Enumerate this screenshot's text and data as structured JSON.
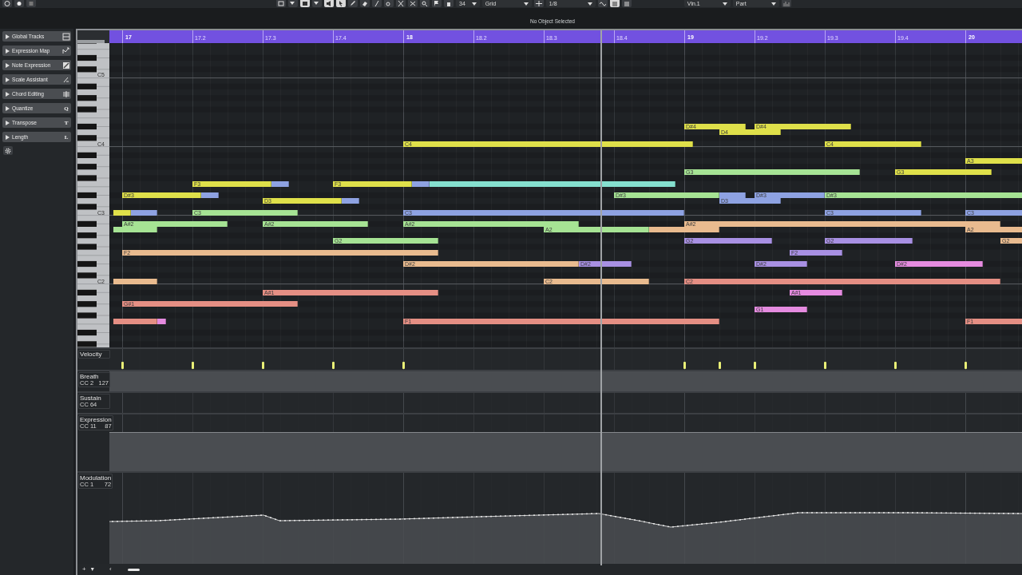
{
  "toolbar": {
    "step": "34",
    "snap_mode": "Grid",
    "quantize": "1/8",
    "track": "Vln.1",
    "part_scope": "Part"
  },
  "info_line": "No Object Selected",
  "inspector": [
    {
      "label": "Global Tracks",
      "expanded": false
    },
    {
      "label": "Expression Map",
      "expanded": false
    },
    {
      "label": "Note Expression",
      "expanded": false
    },
    {
      "label": "Scale Assistant",
      "expanded": false
    },
    {
      "label": "Chord Editing",
      "expanded": false
    },
    {
      "label": "Quantize",
      "expanded": false,
      "key": "Q"
    },
    {
      "label": "Transpose",
      "expanded": false,
      "key": "T"
    },
    {
      "label": "Length",
      "expanded": false,
      "key": "L"
    }
  ],
  "ruler": [
    {
      "label": "17",
      "kind": "bar"
    },
    {
      "label": "17.2",
      "kind": "beat"
    },
    {
      "label": "17.3",
      "kind": "beat"
    },
    {
      "label": "17.4",
      "kind": "beat"
    },
    {
      "label": "18",
      "kind": "bar"
    },
    {
      "label": "18.2",
      "kind": "beat"
    },
    {
      "label": "18.3",
      "kind": "beat"
    },
    {
      "label": "18.4",
      "kind": "beat"
    },
    {
      "label": "19",
      "kind": "bar"
    },
    {
      "label": "19.2",
      "kind": "beat"
    },
    {
      "label": "19.3",
      "kind": "beat"
    },
    {
      "label": "19.4",
      "kind": "beat"
    },
    {
      "label": "20",
      "kind": "bar"
    }
  ],
  "keyboard": {
    "labels": [
      "C5",
      "C4",
      "C3",
      "C2"
    ]
  },
  "notes": [
    {
      "label": "D#4",
      "color": "#dfe04a"
    },
    {
      "label": "D#4",
      "color": "#dfe04a"
    },
    {
      "label": "D4",
      "color": "#dfe04a"
    },
    {
      "label": "C4",
      "color": "#dfe04a"
    },
    {
      "label": "C4",
      "color": "#dfe04a"
    },
    {
      "label": "A3",
      "color": "#dfe04a"
    },
    {
      "label": "G3",
      "color": "#a6e394"
    },
    {
      "label": "G3",
      "color": "#dfe04a"
    },
    {
      "label": "F3",
      "color": "#dfe04a"
    },
    {
      "color": "#8ea2e2"
    },
    {
      "label": "F3",
      "color": "#dfe04a"
    },
    {
      "color": "#8ea2e2"
    },
    {
      "color": "#85e0cf"
    },
    {
      "label": "D#3",
      "color": "#dfe04a"
    },
    {
      "color": "#8ea2e2"
    },
    {
      "label": "D#3",
      "color": "#a6e394"
    },
    {
      "color": "#8ea2e2"
    },
    {
      "label": "D#3",
      "color": "#8ea2e2"
    },
    {
      "label": "D#3",
      "color": "#a6e394"
    },
    {
      "label": "D3",
      "color": "#dfe04a"
    },
    {
      "color": "#8ea2e2"
    },
    {
      "label": "D3",
      "color": "#8ea2e2"
    },
    {
      "color": "#dfe04a"
    },
    {
      "color": "#8ea2e2"
    },
    {
      "label": "C3",
      "color": "#a6e394"
    },
    {
      "label": "C3",
      "color": "#8ea2e2"
    },
    {
      "label": "C3",
      "color": "#8ea2e2"
    },
    {
      "label": "C3",
      "color": "#8ea2e2"
    },
    {
      "label": "A#2",
      "color": "#a6e394"
    },
    {
      "label": "A#2",
      "color": "#a6e394"
    },
    {
      "label": "A#2",
      "color": "#a6e394"
    },
    {
      "label": "A#2",
      "color": "#e9bb8f"
    },
    {
      "color": "#a6e394"
    },
    {
      "label": "A2",
      "color": "#a6e394"
    },
    {
      "color": "#e9bb8f"
    },
    {
      "label": "A2",
      "color": "#e9bb8f"
    },
    {
      "label": "G2",
      "color": "#a6e394"
    },
    {
      "label": "G2",
      "color": "#a890e3"
    },
    {
      "label": "G2",
      "color": "#a890e3"
    },
    {
      "label": "G2",
      "color": "#e9bb8f"
    },
    {
      "label": "F2",
      "color": "#e9bb8f"
    },
    {
      "label": "F2",
      "color": "#a890e3"
    },
    {
      "label": "D#2",
      "color": "#e9bb8f"
    },
    {
      "label": "D#2",
      "color": "#a890e3"
    },
    {
      "label": "D#2",
      "color": "#a890e3"
    },
    {
      "label": "D#2",
      "color": "#e58be0"
    },
    {
      "color": "#e9bb8f"
    },
    {
      "label": "C2",
      "color": "#e9bb8f"
    },
    {
      "label": "C2",
      "color": "#e58f84"
    },
    {
      "label": "A#1",
      "color": "#e58f84"
    },
    {
      "label": "A#1",
      "color": "#e58be0"
    },
    {
      "label": "G#1",
      "color": "#e58f84"
    },
    {
      "label": "G1",
      "color": "#e58be0"
    },
    {
      "color": "#e58f84"
    },
    {
      "color": "#e58be0"
    },
    {
      "label": "F1",
      "color": "#e58f84"
    },
    {
      "label": "F1",
      "color": "#e58f84"
    }
  ],
  "lanes": [
    {
      "kind": "velocity",
      "name": "Velocity"
    },
    {
      "kind": "cc",
      "name": "Breath",
      "cc": "CC 2",
      "value": "127"
    },
    {
      "kind": "cc",
      "name": "Sustain",
      "cc": "CC 64"
    },
    {
      "kind": "cc",
      "name": "Expression",
      "cc": "CC 11",
      "value": "87"
    },
    {
      "kind": "curve",
      "name": "Modulation",
      "cc": "CC 1",
      "value": "72"
    }
  ],
  "bottom_bar": {
    "buttons": [
      "+",
      "▾"
    ],
    "scroll_left": "‹"
  }
}
